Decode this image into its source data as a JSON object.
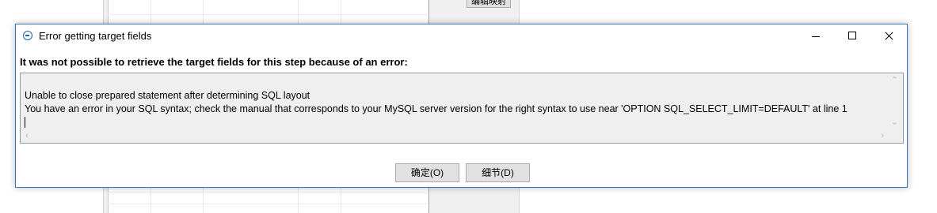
{
  "background_window": {
    "button_label": "编辑映射"
  },
  "dialog": {
    "title": "Error getting target fields",
    "message": "It was not possible to retrieve the target fields for this step because of an error:",
    "details_text": "Unable to close prepared statement after determining SQL layout\nYou have an error in your SQL syntax; check the manual that corresponds to your MySQL server version for the right syntax to use near 'OPTION SQL_SELECT_LIMIT=DEFAULT' at line 1",
    "buttons": {
      "ok_label": "确定(O)",
      "details_label": "细节(D)"
    },
    "icons": {
      "title_icon": "error-circle-icon",
      "minimize": "minimize-icon",
      "maximize": "maximize-icon",
      "close": "close-icon"
    }
  }
}
